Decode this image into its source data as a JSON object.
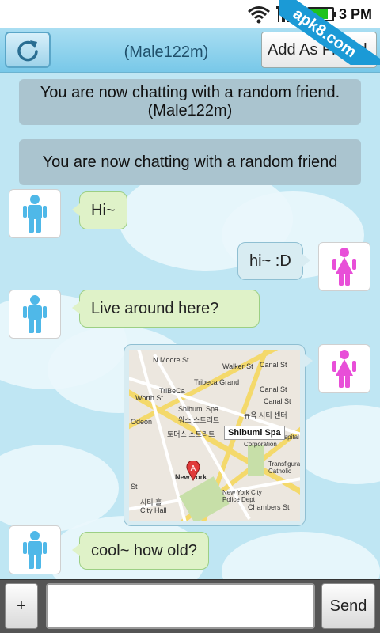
{
  "status_bar": {
    "time": "3 PM",
    "battery_level": 0.85,
    "icons": [
      "wifi-icon",
      "signal-icon",
      "battery-icon"
    ],
    "watermark": "apk8.com"
  },
  "header": {
    "refresh_icon": "refresh-icon",
    "title": "(Male122m)",
    "add_button_label": "Add As Friend"
  },
  "chat": {
    "system_messages": [
      {
        "line1": "You are now chatting with a random friend.",
        "line2": "(Male122m)"
      },
      {
        "line1": "You are now chatting with a random friend",
        "line2": ""
      }
    ],
    "messages": [
      {
        "from": "partner",
        "avatar": "male-avatar-icon",
        "text": "Hi~"
      },
      {
        "from": "me",
        "avatar": "female-avatar-icon",
        "text": "hi~ :D"
      },
      {
        "from": "partner",
        "avatar": "male-avatar-icon",
        "text": "Live around here?"
      },
      {
        "from": "me",
        "avatar": "female-avatar-icon",
        "type": "map"
      },
      {
        "from": "partner",
        "avatar": "male-avatar-icon",
        "text": "cool~ how old?"
      }
    ],
    "map": {
      "tag": "Shibumi Spa",
      "labels": [
        "N Moore St",
        "Walker St",
        "Canal St",
        "TriBeCa",
        "Tribeca Grand",
        "Worth St",
        "Shibumi Spa",
        "Odeon",
        "워스 스트리트",
        "뉴욕 시티 센터",
        "Health and Hospital Corporation",
        "토머스 스트리트",
        "New York",
        "New York City Police Dept",
        "St",
        "시티 홀",
        "City Hall",
        "Chambers St",
        "Transfiguration Catholic"
      ],
      "pin_letter": "A",
      "colors": {
        "road": "#f4d96b",
        "park": "#c7dfa8"
      }
    }
  },
  "input_bar": {
    "plus_label": "+",
    "placeholder": "",
    "send_label": "Send"
  },
  "colors": {
    "background": "#bfe6f3",
    "partner_bubble": "#dff2c8",
    "my_bubble": "#d8ecf2",
    "male_icon": "#4fb8e8",
    "female_icon": "#e84fd8"
  }
}
